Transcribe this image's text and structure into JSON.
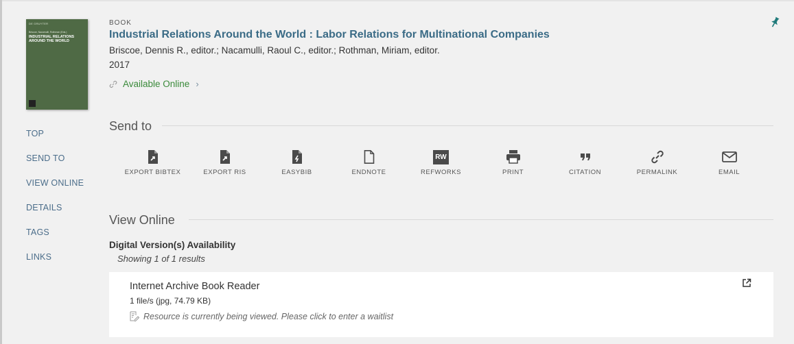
{
  "record": {
    "type": "BOOK",
    "title": "Industrial Relations Around the World : Labor Relations for Multinational Companies",
    "creators": "Briscoe, Dennis R., editor.; Nacamulli, Raoul C., editor.; Rothman, Miriam, editor.",
    "year": "2017",
    "availability": "Available Online"
  },
  "cover": {
    "publisher": "DE GRUYTER",
    "editors": "Briscoe, Nacamulli, Rothman (Eds.)",
    "title": "INDUSTRIAL RELATIONS AROUND THE WORLD",
    "color": "#4f6a45"
  },
  "nav": {
    "items": [
      {
        "label": "TOP"
      },
      {
        "label": "SEND TO"
      },
      {
        "label": "VIEW ONLINE"
      },
      {
        "label": "DETAILS"
      },
      {
        "label": "TAGS"
      },
      {
        "label": "LINKS"
      }
    ]
  },
  "send_to": {
    "heading": "Send to",
    "actions": [
      {
        "label": "EXPORT BIBTEX",
        "icon": "export-bibtex-icon"
      },
      {
        "label": "EXPORT RIS",
        "icon": "export-ris-icon"
      },
      {
        "label": "EASYBIB",
        "icon": "easybib-icon"
      },
      {
        "label": "ENDNOTE",
        "icon": "endnote-icon"
      },
      {
        "label": "REFWORKS",
        "icon": "refworks-icon"
      },
      {
        "label": "PRINT",
        "icon": "print-icon"
      },
      {
        "label": "CITATION",
        "icon": "citation-icon"
      },
      {
        "label": "PERMALINK",
        "icon": "permalink-icon"
      },
      {
        "label": "EMAIL",
        "icon": "email-icon"
      }
    ],
    "refworks_badge": "RW"
  },
  "view_online": {
    "heading": "View Online",
    "digital_title": "Digital Version(s) Availability",
    "showing": "Showing 1 of 1 results",
    "service": {
      "name": "Internet Archive Book Reader",
      "files": "1 file/s (jpg, 74.79 KB)",
      "note": "Resource is currently being viewed. Please click to enter a waitlist"
    }
  },
  "colors": {
    "title": "#3a6b86",
    "available": "#3a8a3a",
    "pin": "#1f7a7a",
    "nav": "#4b6d8a"
  }
}
